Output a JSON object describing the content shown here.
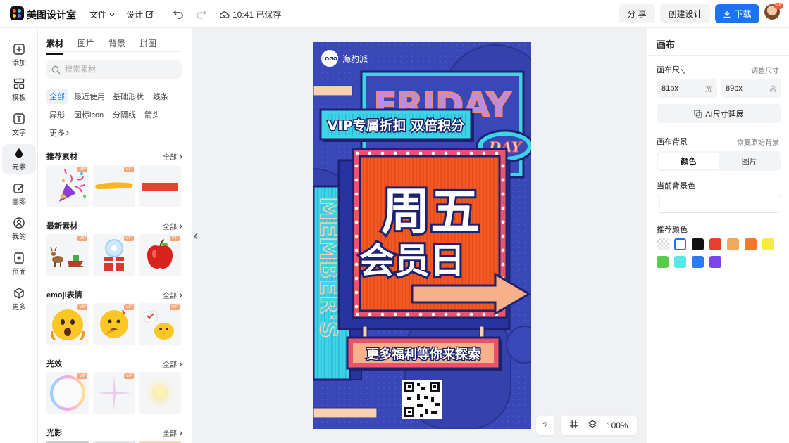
{
  "app": {
    "brand": "美图设计室"
  },
  "topbar": {
    "menu_file": "文件",
    "menu_design": "设计",
    "save_status": "10:41 已保存",
    "share_label": "分 享",
    "create_label": "创建设计",
    "download_label": "下载",
    "avatar_badge": "VIP"
  },
  "leftbar": {
    "items": [
      {
        "label": "添加",
        "icon": "plus-square-icon"
      },
      {
        "label": "模板",
        "icon": "template-grid-icon"
      },
      {
        "label": "文字",
        "icon": "text-icon"
      },
      {
        "label": "元素",
        "icon": "shapes-icon"
      },
      {
        "label": "画图",
        "icon": "pen-icon"
      },
      {
        "label": "我的",
        "icon": "user-icon"
      },
      {
        "label": "页面",
        "icon": "add-page-icon"
      },
      {
        "label": "更多",
        "icon": "cube-icon"
      }
    ],
    "active": "元素"
  },
  "panel": {
    "tabs": [
      "素材",
      "图片",
      "背景",
      "拼图"
    ],
    "search_placeholder": "搜索素材",
    "chips": [
      "全部",
      "最近使用",
      "基础形状",
      "线条",
      "异形",
      "图标icon",
      "分隔线",
      "箭头",
      "更多"
    ],
    "all_label": "全部",
    "vip_label": "VIP",
    "sections": [
      {
        "title": "推荐素材",
        "items": [
          "party-popper",
          "yellow-brush-stroke",
          "red-rectangle"
        ]
      },
      {
        "title": "最新素材",
        "items": [
          "reindeer-sleigh",
          "gift-snowglobe",
          "red-apple"
        ]
      },
      {
        "title": "emoji表情",
        "items": [
          "shocked-face",
          "thinking-face",
          "chick-with-note"
        ]
      },
      {
        "title": "光效",
        "items": [
          "bubble-ring",
          "pink-sparkle",
          "yellow-glow"
        ]
      },
      {
        "title": "光影",
        "items": []
      }
    ]
  },
  "poster": {
    "logo": "LOGO",
    "brand": "海豹派",
    "friday": "FRIDAY",
    "day": "DAY",
    "banner": "VIP专属折扣 双倍积分",
    "title_line1": "周五",
    "title_line2": "会员日",
    "side_text": "MEMBER'S",
    "bottom_banner": "更多福利等你来探索",
    "colors": {
      "bg": "#3a47b8",
      "panel": "#f05a24",
      "cyan": "#3fd3e8",
      "frame": "#e8556a",
      "cream": "#f7d2b0"
    }
  },
  "canvas_controls": {
    "help": "?",
    "grid_icon": "grid-icon",
    "layers_icon": "layers-icon",
    "zoom": "100%"
  },
  "right": {
    "title": "画布",
    "size_label": "画布尺寸",
    "resize_link": "调整尺寸",
    "width_value": "81px",
    "width_unit": "宽",
    "height_value": "89px",
    "height_unit": "高",
    "ai_button": "AI尺寸延展",
    "bg_label": "画布背景",
    "restore_link": "恢复原始背景",
    "seg_color": "颜色",
    "seg_image": "图片",
    "current_label": "当前背景色",
    "recommend_label": "推荐颜色",
    "swatches": [
      "transparent",
      "#ffffff",
      "#111111",
      "#e8402c",
      "#f4a85a",
      "#f07a2a",
      "#f5ec3c",
      "#56cc4a",
      "#56e8ea",
      "#2b7bf0",
      "#7b44ee"
    ]
  }
}
